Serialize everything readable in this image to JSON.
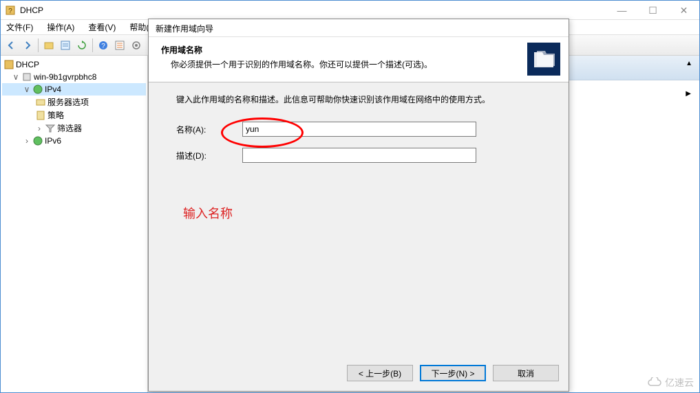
{
  "window": {
    "title": "DHCP",
    "min": "—",
    "max": "☐",
    "close": "✕"
  },
  "menu": {
    "file": "文件(F)",
    "action": "操作(A)",
    "view": "查看(V)",
    "help": "帮助(H)"
  },
  "tree": {
    "root": "DHCP",
    "node1": "win-9b1gvrpbhc8",
    "ipv4": "IPv4",
    "server_options": "服务器选项",
    "policies": "策略",
    "filters": "筛选器",
    "ipv6": "IPv6"
  },
  "dialog": {
    "title": "新建作用域向导",
    "header_title": "作用域名称",
    "header_sub": "你必须提供一个用于识别的作用域名称。你还可以提供一个描述(可选)。",
    "instruction": "键入此作用域的名称和描述。此信息可帮助你快速识别该作用域在网络中的使用方式。",
    "name_label": "名称(A):",
    "name_value": "yun",
    "desc_label": "描述(D):",
    "desc_value": "",
    "annotation": "输入名称",
    "back": "< 上一步(B)",
    "next": "下一步(N) >",
    "cancel": "取消"
  },
  "watermark": "亿速云"
}
